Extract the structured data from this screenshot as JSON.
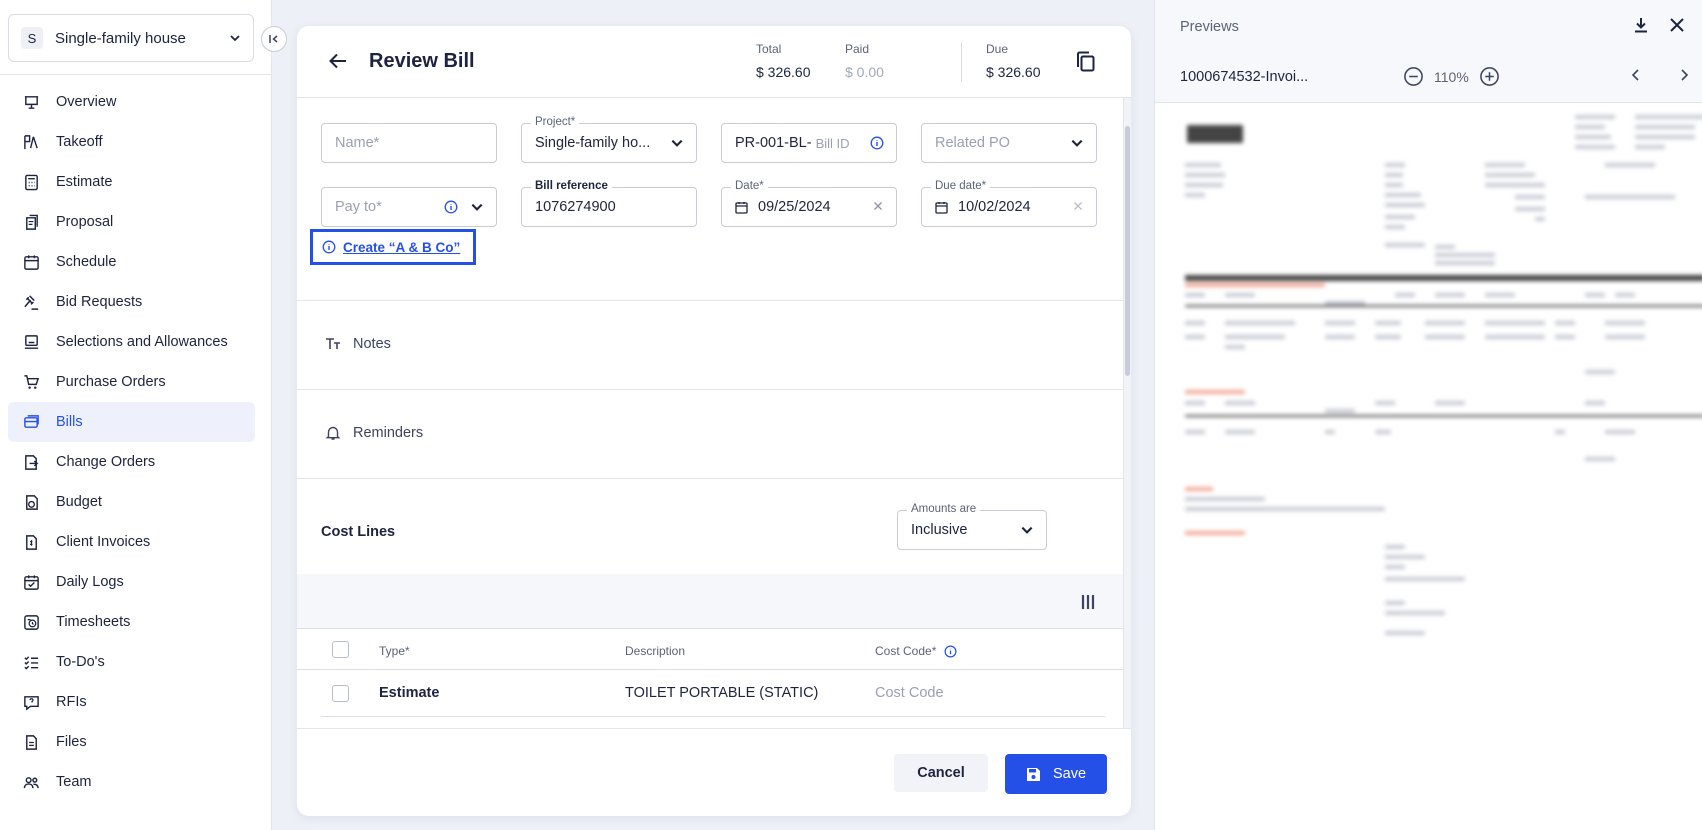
{
  "sidebar": {
    "project": {
      "avatar": "S",
      "name": "Single-family house"
    },
    "items": [
      {
        "label": "Overview",
        "icon": "presentation-icon"
      },
      {
        "label": "Takeoff",
        "icon": "takeoff-icon"
      },
      {
        "label": "Estimate",
        "icon": "calculator-icon"
      },
      {
        "label": "Proposal",
        "icon": "proposal-icon"
      },
      {
        "label": "Schedule",
        "icon": "calendar-icon"
      },
      {
        "label": "Bid Requests",
        "icon": "gavel-icon"
      },
      {
        "label": "Selections and Allowances",
        "icon": "monitor-icon"
      },
      {
        "label": "Purchase Orders",
        "icon": "cart-icon"
      },
      {
        "label": "Bills",
        "icon": "bills-icon",
        "active": true
      },
      {
        "label": "Change Orders",
        "icon": "change-icon"
      },
      {
        "label": "Budget",
        "icon": "budget-icon"
      },
      {
        "label": "Client Invoices",
        "icon": "invoice-icon"
      },
      {
        "label": "Daily Logs",
        "icon": "calendar-check-icon"
      },
      {
        "label": "Timesheets",
        "icon": "timesheet-icon"
      },
      {
        "label": "To-Do's",
        "icon": "checklist-icon"
      },
      {
        "label": "RFIs",
        "icon": "question-icon"
      },
      {
        "label": "Files",
        "icon": "file-icon"
      },
      {
        "label": "Team",
        "icon": "team-icon"
      }
    ]
  },
  "bill": {
    "title": "Review Bill",
    "summary": {
      "total_label": "Total",
      "total_value": "$ 326.60",
      "paid_label": "Paid",
      "paid_value": "$ 0.00",
      "due_label": "Due",
      "due_value": "$ 326.60"
    },
    "fields": {
      "name_placeholder": "Name*",
      "project_label": "Project*",
      "project_value": "Single-family ho...",
      "bill_id_prefix": "PR-001-BL-",
      "bill_id_placeholder": "Bill ID",
      "related_po_placeholder": "Related PO",
      "pay_to_placeholder": "Pay to*",
      "bill_ref_label": "Bill reference",
      "bill_ref_value": "1076274900",
      "date_label": "Date*",
      "date_value": "09/25/2024",
      "due_date_label": "Due date*",
      "due_date_value": "10/02/2024"
    },
    "create_vendor_link": "Create “A & B Co”",
    "sections": {
      "notes": "Notes",
      "reminders": "Reminders"
    },
    "cost_lines": {
      "title": "Cost Lines",
      "amounts_label": "Amounts are",
      "amounts_value": "Inclusive",
      "columns": {
        "type": "Type*",
        "description": "Description",
        "cost_code": "Cost Code*"
      },
      "rows": [
        {
          "type": "Estimate",
          "description": "TOILET PORTABLE (STATIC)",
          "cost_code": "Cost Code"
        }
      ]
    },
    "actions": {
      "cancel": "Cancel",
      "save": "Save"
    }
  },
  "preview": {
    "title": "Previews",
    "file_name": "1000674532-Invoi...",
    "zoom": "110%"
  },
  "colors": {
    "accent": "#2450e8",
    "text": "#1d2340",
    "muted": "#9a9fb3"
  }
}
